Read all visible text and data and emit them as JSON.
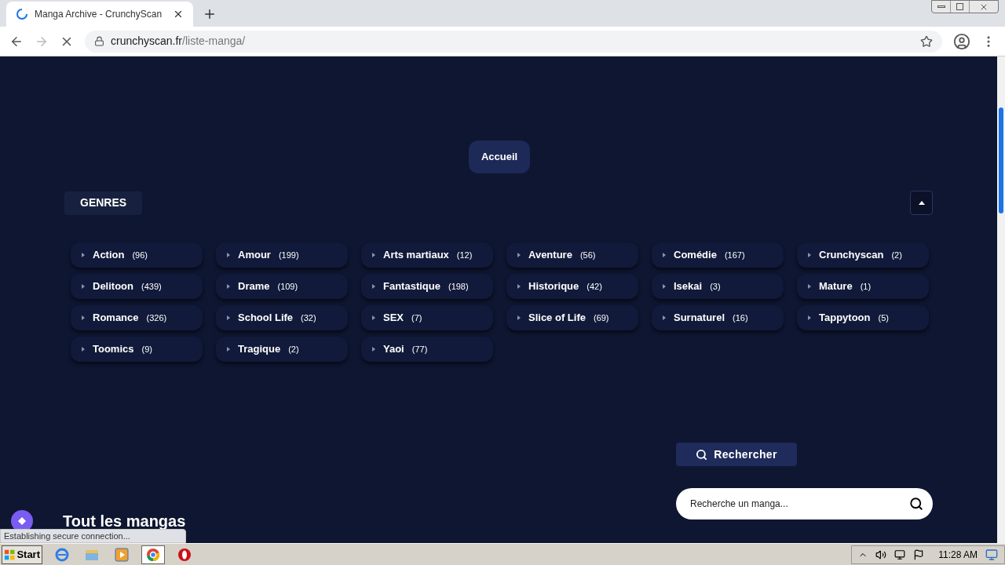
{
  "browser": {
    "tab_title": "Manga Archive - CrunchyScan",
    "url_host": "crunchyscan.fr",
    "url_path": "/liste-manga/",
    "status": "Establishing secure connection..."
  },
  "page": {
    "home_button": "Accueil",
    "genres_tab": "GENRES",
    "genres": [
      {
        "name": "Action",
        "count": "(96)"
      },
      {
        "name": "Amour",
        "count": "(199)"
      },
      {
        "name": "Arts martiaux",
        "count": "(12)"
      },
      {
        "name": "Aventure",
        "count": "(56)"
      },
      {
        "name": "Comédie",
        "count": "(167)"
      },
      {
        "name": "Crunchyscan",
        "count": "(2)"
      },
      {
        "name": "Delitoon",
        "count": "(439)"
      },
      {
        "name": "Drame",
        "count": "(109)"
      },
      {
        "name": "Fantastique",
        "count": "(198)"
      },
      {
        "name": "Historique",
        "count": "(42)"
      },
      {
        "name": "Isekai",
        "count": "(3)"
      },
      {
        "name": "Mature",
        "count": "(1)"
      },
      {
        "name": "Romance",
        "count": "(326)"
      },
      {
        "name": "School Life",
        "count": "(32)"
      },
      {
        "name": "SEX",
        "count": "(7)"
      },
      {
        "name": "Slice of Life",
        "count": "(69)"
      },
      {
        "name": "Surnaturel",
        "count": "(16)"
      },
      {
        "name": "Tappytoon",
        "count": "(5)"
      },
      {
        "name": "Toomics",
        "count": "(9)"
      },
      {
        "name": "Tragique",
        "count": "(2)"
      },
      {
        "name": "Yaoi",
        "count": "(77)"
      }
    ],
    "search_button": "Rechercher",
    "search_placeholder": "Recherche un manga...",
    "heading": "Tout les mangas"
  },
  "taskbar": {
    "start": "Start",
    "apps": [
      {
        "kind": "ie",
        "selected": false
      },
      {
        "kind": "folder",
        "selected": false
      },
      {
        "kind": "media",
        "selected": false
      },
      {
        "kind": "chrome",
        "selected": true
      },
      {
        "kind": "opera",
        "selected": false
      }
    ],
    "clock": "11:28 AM"
  }
}
